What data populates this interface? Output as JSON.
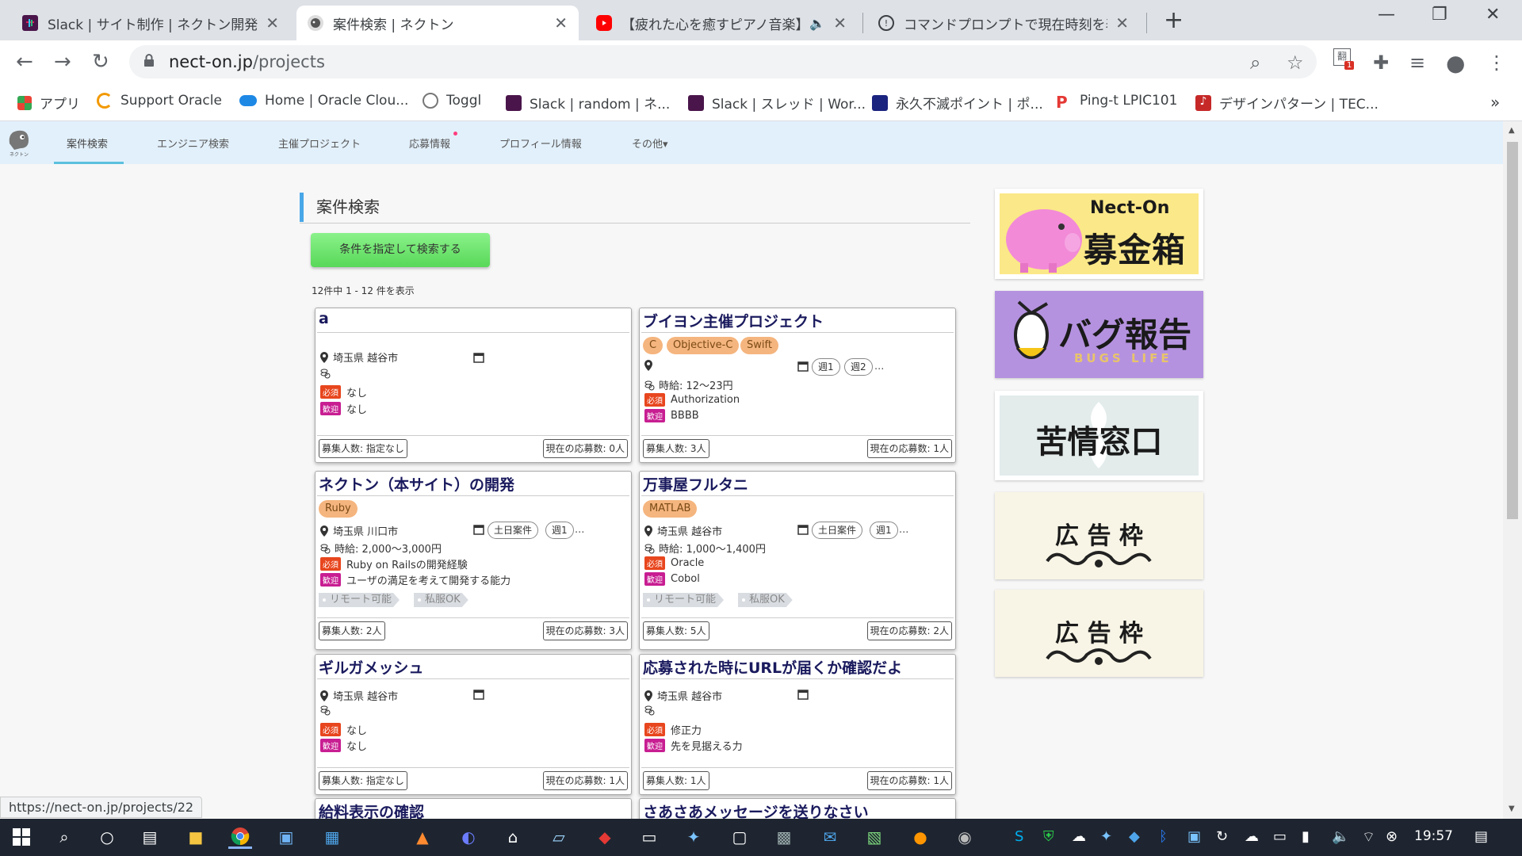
{
  "tabs": [
    {
      "title": "Slack | サイト制作 | ネクトン開発"
    },
    {
      "title": "案件検索 | ネクトン"
    },
    {
      "title": "【疲れた心を癒すピアノ音楽】天"
    },
    {
      "title": "コマンドプロンプトで現在時刻を表示"
    }
  ],
  "omnibox": {
    "host": "nect-on.jp",
    "path": "/projects"
  },
  "bookmarks": [
    {
      "label": "アプリ"
    },
    {
      "label": "Support Oracle"
    },
    {
      "label": "Home | Oracle Clou..."
    },
    {
      "label": "Toggl"
    },
    {
      "label": "Slack | random | ネ..."
    },
    {
      "label": "Slack | スレッド | Wor..."
    },
    {
      "label": "永久不滅ポイント | ポ..."
    },
    {
      "label": "Ping-t LPIC101"
    },
    {
      "label": "デザインパターン | TEC..."
    }
  ],
  "extension_badge": "1",
  "site": {
    "logo_text": "ネクトン",
    "nav": [
      "案件検索",
      "エンジニア検索",
      "主催プロジェクト",
      "応募情報",
      "プロフィール情報",
      "その他▾"
    ]
  },
  "page": {
    "heading": "案件検索",
    "search_button": "条件を指定して検索する",
    "count": "12件中 1 - 12 件を表示"
  },
  "cards": [
    {
      "title": "a",
      "location": "埼玉県 越谷市",
      "wage": "",
      "required": "なし",
      "welcome": "なし",
      "recruit": "募集人数: 指定なし",
      "applicants": "現在の応募数: 0人"
    },
    {
      "title": "ブイヨン主催プロジェクト",
      "skills": [
        "C",
        "Objective-C",
        "Swift"
      ],
      "location": "",
      "periods": [
        "週1",
        "週2"
      ],
      "more": "...",
      "wage": "時給: 12～23円",
      "required": "Authorization",
      "welcome": "BBBB",
      "recruit": "募集人数: 3人",
      "applicants": "現在の応募数: 1人"
    },
    {
      "title": "ネクトン（本サイト）の開発",
      "skills": [
        "Ruby"
      ],
      "location": "埼玉県 川口市",
      "periods": [
        "土日案件",
        "週1"
      ],
      "more": "...",
      "wage": "時給: 2,000～3,000円",
      "required": "Ruby on Railsの開発経験",
      "welcome": "ユーザの満足を考えて開発する能力",
      "features": [
        "リモート可能",
        "私服OK"
      ],
      "recruit": "募集人数: 2人",
      "applicants": "現在の応募数: 3人"
    },
    {
      "title": "万事屋フルタニ",
      "skills": [
        "MATLAB"
      ],
      "location": "埼玉県 越谷市",
      "periods": [
        "土日案件",
        "週1"
      ],
      "more": "...",
      "wage": "時給: 1,000～1,400円",
      "required": "Oracle",
      "welcome": "Cobol",
      "features": [
        "リモート可能",
        "私服OK"
      ],
      "recruit": "募集人数: 5人",
      "applicants": "現在の応募数: 2人"
    },
    {
      "title": "ギルガメッシュ",
      "location": "埼玉県 越谷市",
      "wage": "",
      "required": "なし",
      "welcome": "なし",
      "recruit": "募集人数: 指定なし",
      "applicants": "現在の応募数: 1人"
    },
    {
      "title": "応募された時にURLが届くか確認だよ",
      "location": "埼玉県 越谷市",
      "wage": "",
      "required": "修正力",
      "welcome": "先を見据える力",
      "recruit": "募集人数: 1人",
      "applicants": "現在の応募数: 1人"
    },
    {
      "title": "給料表示の確認"
    },
    {
      "title": "さあさあメッセージを送りなさい"
    }
  ],
  "labels": {
    "required": "必須",
    "welcome": "歓迎"
  },
  "banners": [
    {
      "brand": "Nect-On",
      "text": "募金箱"
    },
    {
      "text": "バグ報告",
      "sub": "BUGS LIFE"
    },
    {
      "text": "苦情窓口"
    },
    {
      "text": "広 告 枠"
    },
    {
      "text": "広 告 枠"
    }
  ],
  "status_url": "https://nect-on.jp/projects/22",
  "clock": "19:57",
  "colors": {
    "nav_bg": "#e2f0fb",
    "accent_blue": "#49a7e8",
    "button_green": "#58d858",
    "required_red": "#e8461e",
    "welcome_magenta": "#c81e92",
    "skill_orange": "#f5b57e",
    "title_navy": "#1a1a5e"
  }
}
